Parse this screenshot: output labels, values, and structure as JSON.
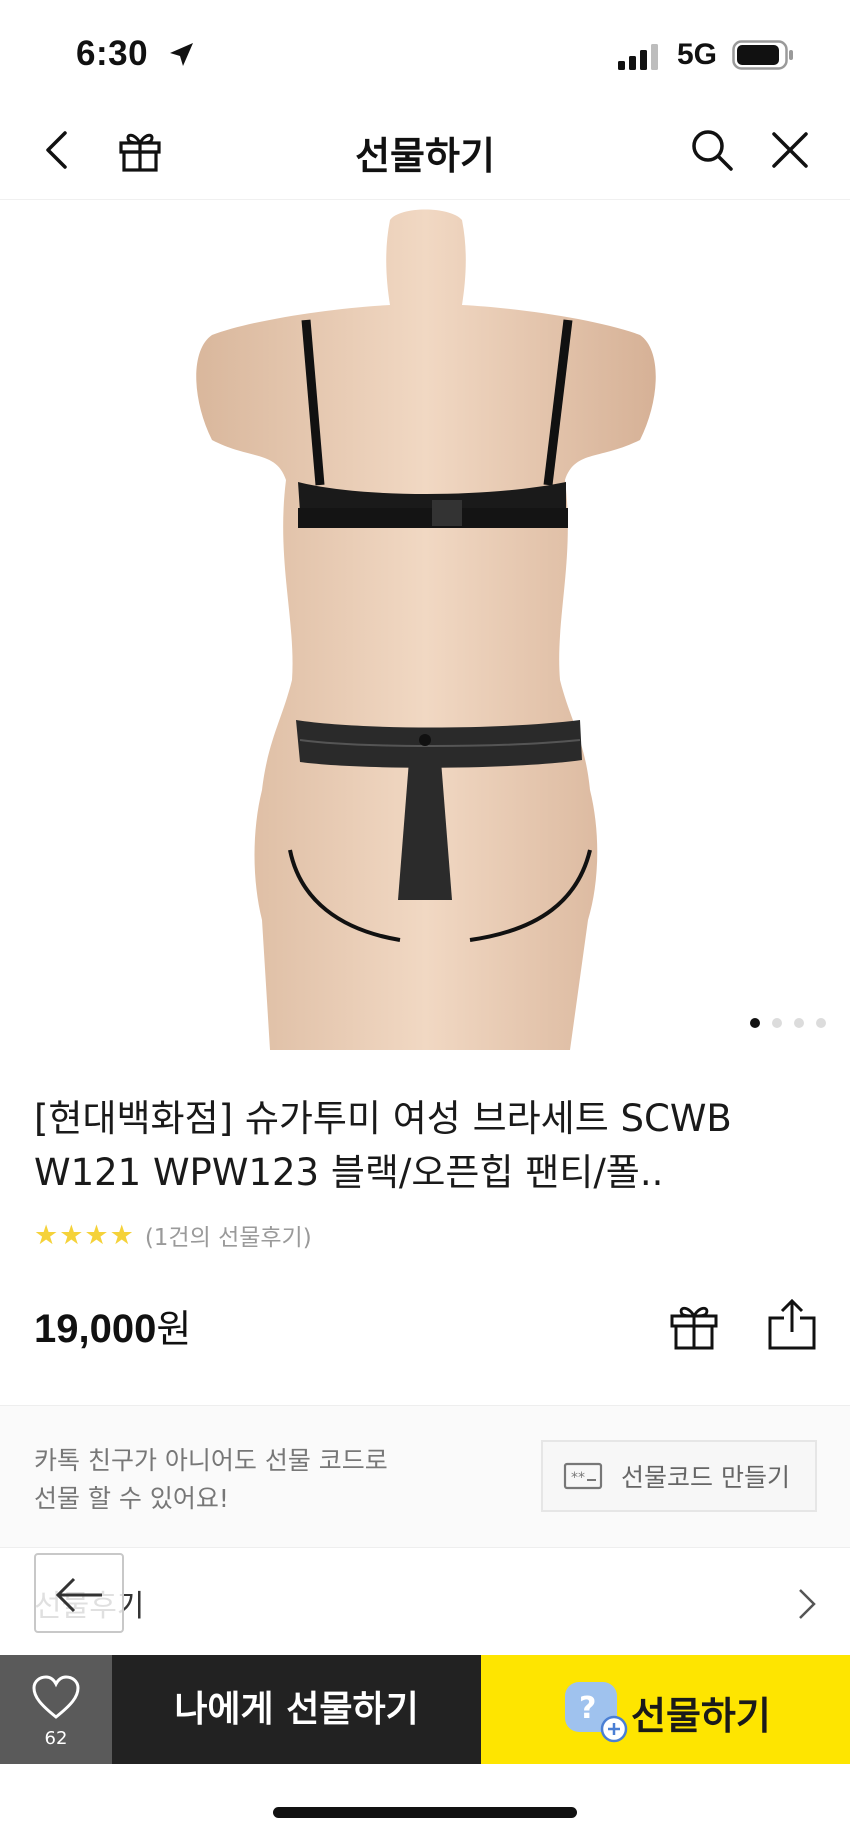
{
  "status": {
    "time": "6:30",
    "network": "5G"
  },
  "nav": {
    "title": "선물하기"
  },
  "product": {
    "title": "[현대백화점] 슈가투미 여성 브라세트 SCWB W121 WPW123 블랙/오픈힙 팬티/폴..",
    "stars": "★★★★",
    "review_text": "(1건의 선물후기)",
    "price": "19,000",
    "currency": "원",
    "image_count": 4,
    "image_index": 1
  },
  "gift_code": {
    "description_line1": "카톡 친구가 아니어도 선물 코드로",
    "description_line2": "선물 할 수 있어요!",
    "button_label": "선물코드 만들기"
  },
  "more": {
    "label": "선물후기"
  },
  "bottom": {
    "like_count": "62",
    "self_gift_label": "나에게 선물하기",
    "gift_label": "선물하기"
  },
  "colors": {
    "gift_yellow": "#fee500",
    "dark_button": "#222222",
    "like_bg": "#5a5a5a",
    "star": "#f5d23a"
  }
}
